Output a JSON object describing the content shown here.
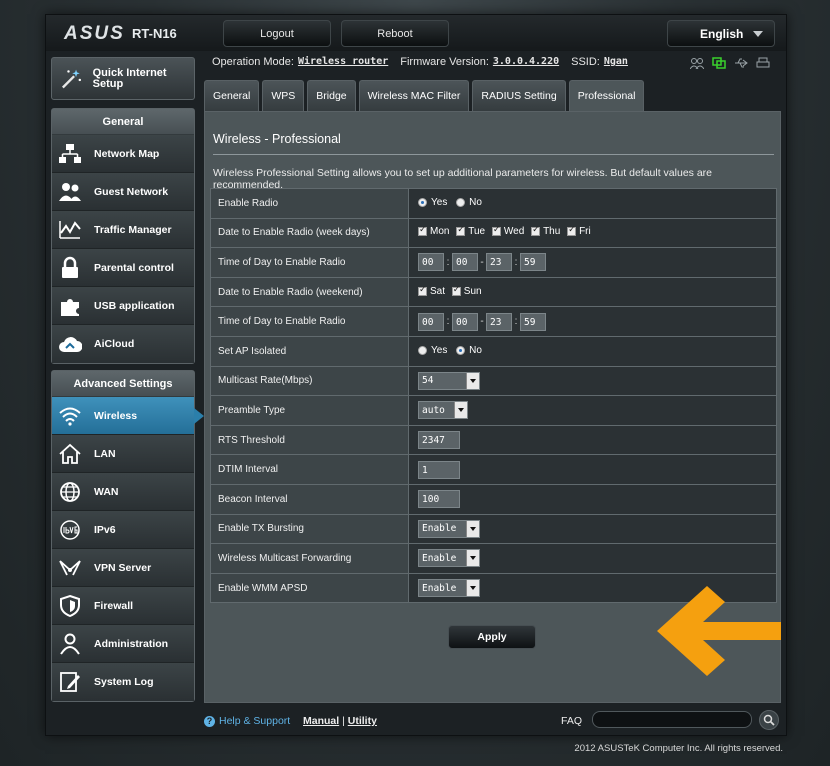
{
  "brand": {
    "logo": "ASUS",
    "model": "RT-N16"
  },
  "topbar": {
    "logout": "Logout",
    "reboot": "Reboot",
    "language": "English"
  },
  "status": {
    "op_mode_label": "Operation Mode:",
    "op_mode_value": "Wireless router",
    "firmware_label": "Firmware Version:",
    "firmware_value": "3.0.0.4.220",
    "ssid_label": "SSID:",
    "ssid_value": "Ngan"
  },
  "sidebar": {
    "quick": "Quick Internet Setup",
    "general_title": "General",
    "general": [
      "Network Map",
      "Guest Network",
      "Traffic Manager",
      "Parental control",
      "USB application",
      "AiCloud"
    ],
    "advanced_title": "Advanced Settings",
    "advanced": [
      "Wireless",
      "LAN",
      "WAN",
      "IPv6",
      "VPN Server",
      "Firewall",
      "Administration",
      "System Log"
    ]
  },
  "tabs": [
    "General",
    "WPS",
    "Bridge",
    "Wireless MAC Filter",
    "RADIUS Setting",
    "Professional"
  ],
  "page": {
    "title": "Wireless - Professional",
    "description": "Wireless Professional Setting allows you to set up additional parameters for wireless. But default values are recommended.",
    "apply": "Apply"
  },
  "settings": {
    "enable_radio": {
      "label": "Enable Radio",
      "opt1": "Yes",
      "opt2": "No"
    },
    "weekdays": {
      "label": "Date to Enable Radio (week days)",
      "days": [
        "Mon",
        "Tue",
        "Wed",
        "Thu",
        "Fri"
      ]
    },
    "time_weekdays": {
      "label": "Time of Day to Enable Radio",
      "v": [
        "00",
        "00",
        "23",
        "59"
      ]
    },
    "weekend": {
      "label": "Date to Enable Radio (weekend)",
      "days": [
        "Sat",
        "Sun"
      ]
    },
    "time_weekend": {
      "label": "Time of Day to Enable Radio",
      "v": [
        "00",
        "00",
        "23",
        "59"
      ]
    },
    "ap_isolated": {
      "label": "Set AP Isolated",
      "opt1": "Yes",
      "opt2": "No"
    },
    "multicast_rate": {
      "label": "Multicast Rate(Mbps)",
      "value": "54"
    },
    "preamble": {
      "label": "Preamble Type",
      "value": "auto"
    },
    "rts": {
      "label": "RTS Threshold",
      "value": "2347"
    },
    "dtim": {
      "label": "DTIM Interval",
      "value": "1"
    },
    "beacon": {
      "label": "Beacon Interval",
      "value": "100"
    },
    "tx_bursting": {
      "label": "Enable TX Bursting",
      "value": "Enable"
    },
    "multicast_fwd": {
      "label": "Wireless Multicast Forwarding",
      "value": "Enable"
    },
    "wmm_apsd": {
      "label": "Enable WMM APSD",
      "value": "Enable"
    }
  },
  "footer": {
    "help": "Help & Support",
    "manual": "Manual",
    "divider": "|",
    "utility": "Utility",
    "faq": "FAQ",
    "copyright": "2012 ASUSTeK Computer Inc. All rights reserved."
  },
  "colors": {
    "accent": "#2b7fab",
    "arrow": "#f5a00f",
    "help_link": "#5fb3e6"
  }
}
